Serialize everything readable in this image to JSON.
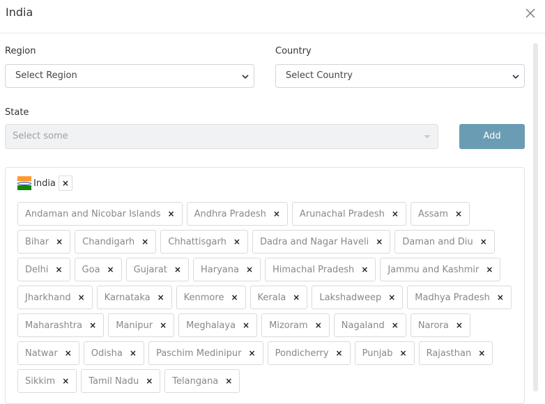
{
  "modal": {
    "title": "India"
  },
  "form": {
    "region": {
      "label": "Region",
      "value": "Select Region"
    },
    "country": {
      "label": "Country",
      "value": "Select Country"
    },
    "state": {
      "label": "State",
      "placeholder": "Select some"
    },
    "add_label": "Add"
  },
  "selected_country": {
    "name": "India",
    "flag_icon": "india-flag-icon",
    "remove_symbol": "×"
  },
  "tag_remove_symbol": "×",
  "states": [
    "Andaman and Nicobar Islands",
    "Andhra Pradesh",
    "Arunachal Pradesh",
    "Assam",
    "Bihar",
    "Chandigarh",
    "Chhattisgarh",
    "Dadra and Nagar Haveli",
    "Daman and Diu",
    "Delhi",
    "Goa",
    "Gujarat",
    "Haryana",
    "Himachal Pradesh",
    "Jammu and Kashmir",
    "Jharkhand",
    "Karnataka",
    "Kenmore",
    "Kerala",
    "Lakshadweep",
    "Madhya Pradesh",
    "Maharashtra",
    "Manipur",
    "Meghalaya",
    "Mizoram",
    "Nagaland",
    "Narora",
    "Natwar",
    "Odisha",
    "Paschim Medinipur",
    "Pondicherry",
    "Punjab",
    "Rajasthan",
    "Sikkim",
    "Tamil Nadu",
    "Telangana"
  ],
  "colors": {
    "add_button": "#6a9db3",
    "disabled_field": "#f1f2f4",
    "tag_text": "#888888"
  }
}
